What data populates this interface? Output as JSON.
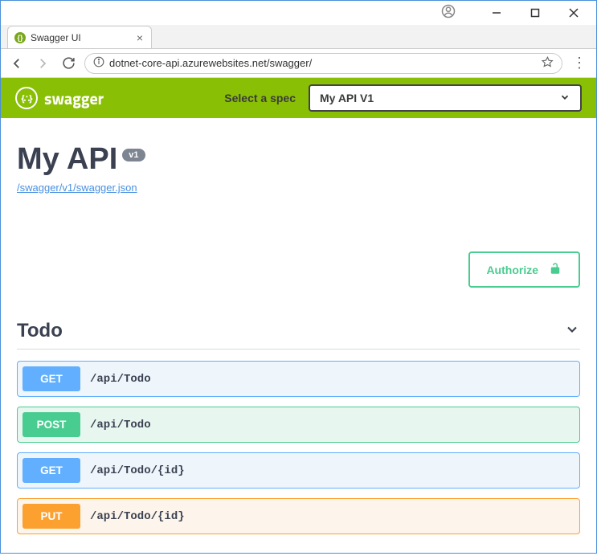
{
  "window": {
    "tab_title": "Swagger UI"
  },
  "url": "dotnet-core-api.azurewebsites.net/swagger/",
  "header": {
    "brand": "swagger",
    "spec_label": "Select a spec",
    "spec_selected": "My API V1"
  },
  "api": {
    "title": "My API",
    "version": "v1",
    "spec_link": "/swagger/v1/swagger.json"
  },
  "authorize_label": "Authorize",
  "section": {
    "name": "Todo"
  },
  "operations": [
    {
      "method": "GET",
      "path": "/api/Todo",
      "cls": "op-get"
    },
    {
      "method": "POST",
      "path": "/api/Todo",
      "cls": "op-post"
    },
    {
      "method": "GET",
      "path": "/api/Todo/{id}",
      "cls": "op-get"
    },
    {
      "method": "PUT",
      "path": "/api/Todo/{id}",
      "cls": "op-put"
    }
  ]
}
